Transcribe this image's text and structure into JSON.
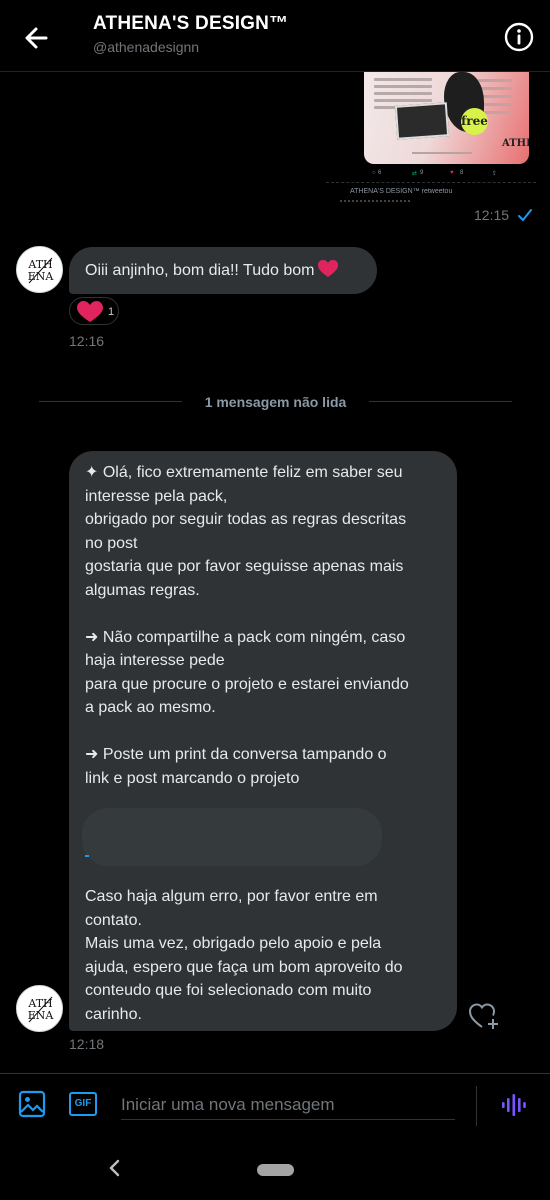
{
  "header": {
    "title": "ATHENA'S DESIGN™",
    "handle": "@athenadesignn"
  },
  "shared_tweet": {
    "badge": "free",
    "logo": "ATHENA",
    "replies": "6",
    "retweets": "9",
    "likes": "8",
    "retweet_note": "ATHENA'S DESIGN™ retweetou"
  },
  "messages": [
    {
      "time": "12:15"
    },
    {
      "text": "Oiii anjinho, bom dia!! Tudo bom",
      "reaction_count": "1",
      "time": "12:16"
    }
  ],
  "divider": {
    "label": "1 mensagem não lida"
  },
  "long_message": {
    "para1_line1": "✦ Olá, fico extremamente feliz em saber seu",
    "para1_line2": "interesse pela pack,",
    "para1_line3": "obrigado por seguir todas as regras descritas",
    "para1_line4": "no post",
    "para1_line5": "gostaria que por favor seguisse apenas mais",
    "para1_line6": "algumas regras.",
    "para2_line1": "➜ Não compartilhe a pack com ningém, caso",
    "para2_line2": "haja interesse pede",
    "para2_line3": "para que procure o projeto e estarei enviando",
    "para2_line4": "a pack ao mesmo.",
    "para3_line1": "➜ Poste um print da conversa tampando o",
    "para3_line2": "link e post marcando o projeto",
    "para4_line1": "Caso haja algum erro, por favor entre em",
    "para4_line2": "contato.",
    "para4_line3": "Mais uma vez, obrigado pelo apoio e pela",
    "para4_line4": "ajuda, espero que faça um bom aproveito do",
    "para4_line5": "conteudo que foi selecionado com muito",
    "para4_line6": "carinho.",
    "time": "12:18"
  },
  "composer": {
    "gif_label": "GIF",
    "placeholder": "Iniciar uma nova mensagem"
  },
  "colors": {
    "accent": "#1d9bf0",
    "bubble": "#2f3336",
    "heart": "#f91880",
    "voice": "#7856ff"
  }
}
